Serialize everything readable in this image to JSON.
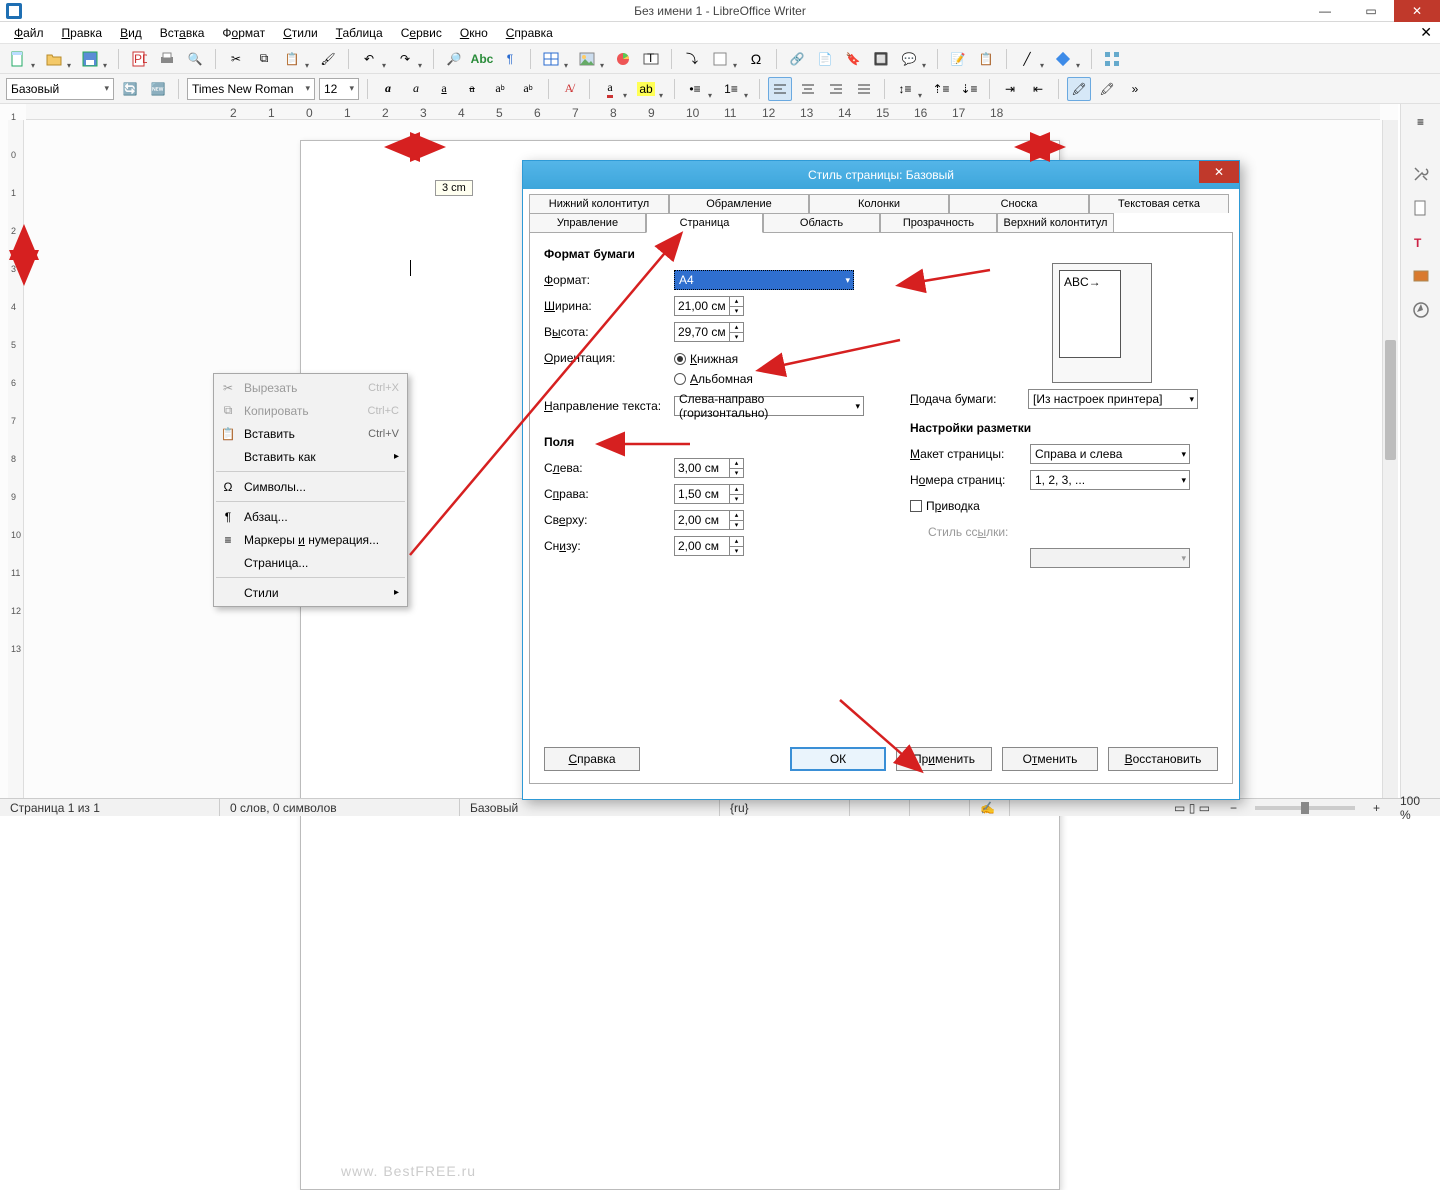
{
  "window": {
    "title": "Без имени 1 - LibreOffice Writer"
  },
  "menu": {
    "items": [
      "Файл",
      "Правка",
      "Вид",
      "Вставка",
      "Формат",
      "Стили",
      "Таблица",
      "Сервис",
      "Окно",
      "Справка"
    ]
  },
  "toolbar2": {
    "style": "Базовый",
    "font": "Times New Roman",
    "size": "12"
  },
  "ruler_tooltip": "3  cm",
  "context_menu": {
    "cut": "Вырезать",
    "cut_sc": "Ctrl+X",
    "copy": "Копировать",
    "copy_sc": "Ctrl+C",
    "paste": "Вставить",
    "paste_sc": "Ctrl+V",
    "paste_as": "Вставить как",
    "symbols": "Символы...",
    "paragraph": "Абзац...",
    "bullets": "Маркеры и нумерация...",
    "page": "Страница...",
    "styles": "Стили"
  },
  "dialog": {
    "title": "Стиль страницы: Базовый",
    "tabs_row1": [
      "Нижний колонтитул",
      "Обрамление",
      "Колонки",
      "Сноска",
      "Текстовая сетка"
    ],
    "tabs_row2": [
      "Управление",
      "Страница",
      "Область",
      "Прозрачность",
      "Верхний колонтитул"
    ],
    "active_tab_label": "Страница",
    "paper": {
      "group": "Формат бумаги",
      "format_label": "Формат:",
      "format_value": "A4",
      "width_label": "Ширина:",
      "width_value": "21,00 см",
      "height_label": "Высота:",
      "height_value": "29,70 см",
      "orient_label": "Ориентация:",
      "orient_portrait": "Книжная",
      "orient_landscape": "Альбомная",
      "textdir_label": "Направление текста:",
      "textdir_value": "Слева-направо (горизонтально)",
      "tray_label": "Подача бумаги:",
      "tray_value": "[Из настроек принтера]"
    },
    "margins": {
      "group": "Поля",
      "left_label": "Слева:",
      "left_value": "3,00 см",
      "right_label": "Справа:",
      "right_value": "1,50 см",
      "top_label": "Сверху:",
      "top_value": "2,00 см",
      "bottom_label": "Снизу:",
      "bottom_value": "2,00 см"
    },
    "layout": {
      "group": "Настройки разметки",
      "layout_label": "Макет страницы:",
      "layout_value": "Справа и слева",
      "numbers_label": "Номера страниц:",
      "numbers_value": "1, 2, 3, ...",
      "register_label": "Приводка",
      "refstyle_label": "Стиль ссылки:"
    },
    "preview_text": "ABC→",
    "buttons": {
      "help": "Справка",
      "ok": "ОК",
      "apply": "Применить",
      "cancel": "Отменить",
      "restore": "Восстановить"
    }
  },
  "status": {
    "page": "Страница 1 из 1",
    "words": "0 слов, 0 символов",
    "style": "Базовый",
    "lang": "{ru}",
    "zoom": "100 %"
  },
  "watermark": "www. BestFREE.ru"
}
